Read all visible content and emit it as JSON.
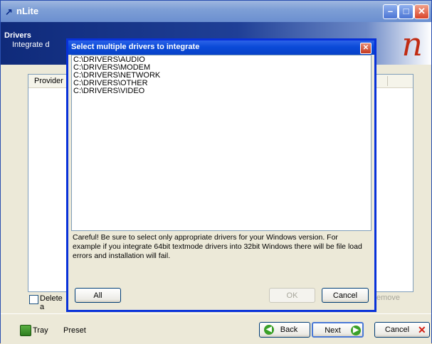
{
  "window": {
    "title": "nLite"
  },
  "banner": {
    "title": "Drivers",
    "subtitle": "Integrate d"
  },
  "main": {
    "column_header": "Provider",
    "delete_checkbox_label": "Delete a",
    "remove_button_label": "emove"
  },
  "bottom": {
    "tray_label": "Tray",
    "preset_label": "Preset",
    "back_label": "Back",
    "next_label": "Next",
    "cancel_label": "Cancel"
  },
  "dialog": {
    "title": "Select multiple drivers to integrate",
    "items": [
      "C:\\DRIVERS\\AUDIO",
      "C:\\DRIVERS\\MODEM",
      "C:\\DRIVERS\\NETWORK",
      "C:\\DRIVERS\\OTHER",
      "C:\\DRIVERS\\VIDEO"
    ],
    "note": "Careful! Be sure to select only appropriate drivers for your Windows version. For example if you integrate 64bit textmode drivers into 32bit Windows there will be file load errors and installation will fail.",
    "all_label": "All",
    "ok_label": "OK",
    "cancel_label": "Cancel"
  }
}
